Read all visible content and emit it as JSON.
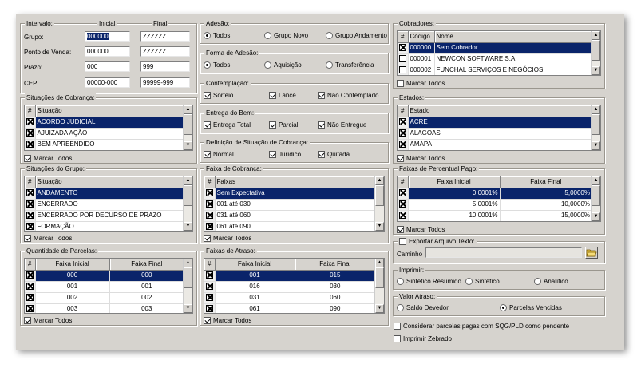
{
  "intervalo": {
    "title": "Intervalo:",
    "inicial": "Inicial",
    "final": "Final",
    "rows": [
      {
        "label": "Grupo:",
        "ini": "000000",
        "fin": "ZZZZZZ"
      },
      {
        "label": "Ponto de Venda:",
        "ini": "000000",
        "fin": "ZZZZZZ"
      },
      {
        "label": "Prazo:",
        "ini": "000",
        "fin": "999"
      },
      {
        "label": "CEP:",
        "ini": "00000-000",
        "fin": "99999-999"
      }
    ]
  },
  "situacoes_cobranca": {
    "title": "Situações de Cobrança:",
    "hash": "#",
    "col": "Situação",
    "rows": [
      "ACORDO JUDICIAL",
      "AJUIZADA AÇÃO",
      "BEM APREENDIDO"
    ],
    "marcar": "Marcar Todos"
  },
  "situacoes_grupo": {
    "title": "Situações do Grupo:",
    "hash": "#",
    "col": "Situação",
    "rows": [
      "ANDAMENTO",
      "ENCERRADO",
      "ENCERRADO POR DECURSO DE PRAZO",
      "FORMAÇÃO"
    ],
    "marcar": "Marcar Todos"
  },
  "quantidade_parcelas": {
    "title": "Quantidade de Parcelas:",
    "hash": "#",
    "col1": "Faixa Inicial",
    "col2": "Faixa Final",
    "rows": [
      [
        "000",
        "000"
      ],
      [
        "001",
        "001"
      ],
      [
        "002",
        "002"
      ],
      [
        "003",
        "003"
      ]
    ],
    "marcar": "Marcar Todos"
  },
  "adesao": {
    "title": "Adesão:",
    "options": [
      "Todos",
      "Grupo Novo",
      "Grupo Andamento"
    ]
  },
  "forma_adesao": {
    "title": "Forma de Adesão:",
    "options": [
      "Todos",
      "Aquisição",
      "Transferência"
    ]
  },
  "contemplacao": {
    "title": "Contemplação:",
    "options": [
      "Sorteio",
      "Lance",
      "Não Contemplado"
    ]
  },
  "entrega_bem": {
    "title": "Entrega do Bem:",
    "options": [
      "Entrega Total",
      "Parcial",
      "Não Entregue"
    ]
  },
  "definicao": {
    "title": "Definição de Situação de Cobrança:",
    "options": [
      "Normal",
      "Jurídico",
      "Quitada"
    ]
  },
  "faixa_cobranca": {
    "title": "Faixa de Cobrança:",
    "hash": "#",
    "col": "Faixas",
    "rows": [
      "Sem Expectativa",
      "001 até 030",
      "031 até 060",
      "061 até 090"
    ],
    "marcar": "Marcar Todos"
  },
  "faixas_atraso": {
    "title": "Faixas de Atraso:",
    "hash": "#",
    "col1": "Faixa Inicial",
    "col2": "Faixa Final",
    "rows": [
      [
        "001",
        "015"
      ],
      [
        "016",
        "030"
      ],
      [
        "031",
        "060"
      ],
      [
        "061",
        "090"
      ]
    ],
    "marcar": "Marcar Todos"
  },
  "cobradores": {
    "title": "Cobradores:",
    "hash": "#",
    "col1": "Código",
    "col2": "Nome",
    "rows": [
      [
        "000000",
        "Sem Cobrador"
      ],
      [
        "000001",
        "NEWCON SOFTWARE S.A."
      ],
      [
        "000002",
        "FUNCHAL SERVIÇOS E NEGÓCIOS"
      ]
    ],
    "marcar": "Marcar Todos"
  },
  "estados": {
    "title": "Estados:",
    "hash": "#",
    "col": "Estado",
    "rows": [
      "ACRE",
      "ALAGOAS",
      "AMAPA"
    ],
    "marcar": "Marcar Todos"
  },
  "faixas_percentual": {
    "title": "Faixas de Percentual Pago:",
    "hash": "#",
    "col1": "Faixa Inicial",
    "col2": "Faixa Final",
    "rows": [
      [
        "0,0001%",
        "5,0000%"
      ],
      [
        "5,0001%",
        "10,0000%"
      ],
      [
        "10,0001%",
        "15,0000%"
      ]
    ],
    "marcar": "Marcar Todos"
  },
  "exportar": {
    "label": "Exportar Arquivo Texto:",
    "caminho": "Caminho",
    "value": ""
  },
  "imprimir": {
    "title": "Imprimir:",
    "options": [
      "Sintético Resumido",
      "Sintético",
      "Analítico"
    ]
  },
  "valor_atraso": {
    "title": "Valor Atraso:",
    "options": [
      "Saldo Devedor",
      "Parcelas Vencidas"
    ]
  },
  "considerar": "Considerar parcelas pagas com SQG/PLD como pendente",
  "zebrado": "Imprimir Zebrado"
}
